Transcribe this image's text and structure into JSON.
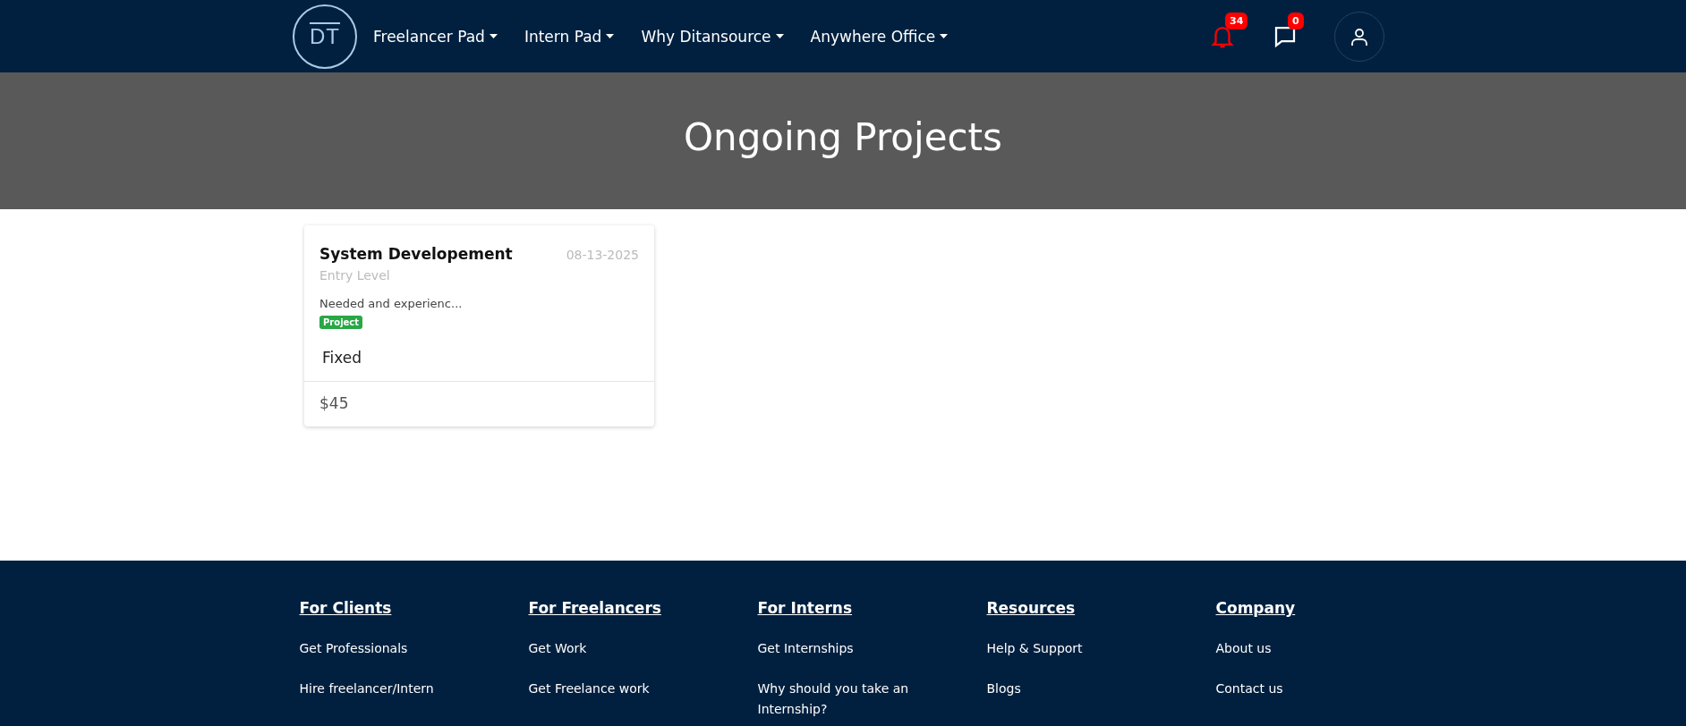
{
  "header": {
    "logo_text": "DT",
    "nav": [
      {
        "label": "Freelancer Pad"
      },
      {
        "label": "Intern Pad"
      },
      {
        "label": "Why Ditansource"
      },
      {
        "label": "Anywhere Office"
      }
    ],
    "notifications": {
      "count": "34"
    },
    "messages": {
      "count": "0"
    }
  },
  "banner": {
    "title": "Ongoing Projects"
  },
  "projects": [
    {
      "title": "System Developement",
      "date": "08-13-2025",
      "level": "Entry Level",
      "description": "Needed and experienc...",
      "tag": "Project",
      "type": "Fixed",
      "price": "$45"
    }
  ],
  "footer": {
    "columns": [
      {
        "heading": "For Clients",
        "links": [
          "Get Professionals",
          "Hire freelancer/Intern"
        ]
      },
      {
        "heading": "For Freelancers",
        "links": [
          "Get Work",
          "Get Freelance work"
        ]
      },
      {
        "heading": "For Interns",
        "links": [
          "Get Internships",
          "Why should you take an Internship?"
        ]
      },
      {
        "heading": "Resources",
        "links": [
          "Help & Support",
          "Blogs"
        ]
      },
      {
        "heading": "Company",
        "links": [
          "About us",
          "Contact us"
        ]
      }
    ]
  }
}
